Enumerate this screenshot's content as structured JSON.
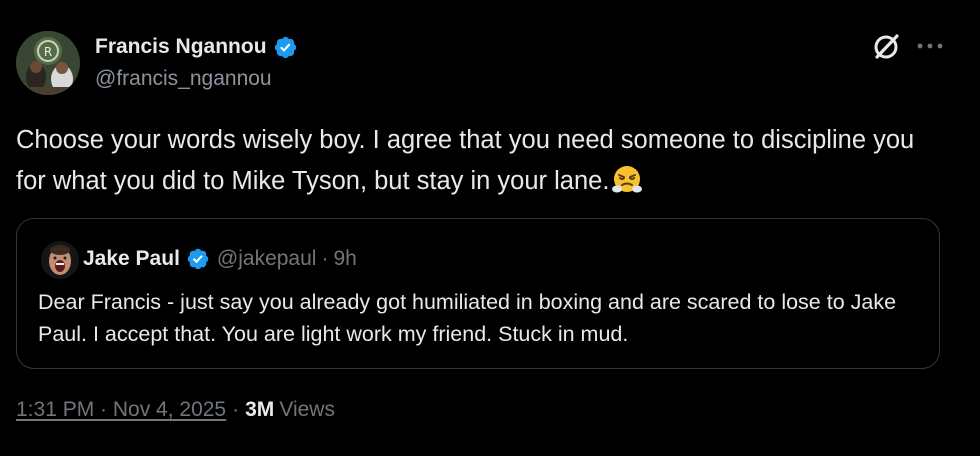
{
  "author": {
    "display_name": "Francis Ngannou",
    "handle": "@francis_ngannou",
    "verified": true
  },
  "tweet": {
    "text": "Choose your words wisely boy. I agree that you need someone to discipline you for what you did to Mike Tyson, but stay in your lane.",
    "emoji": "face-with-steam-from-nose"
  },
  "quoted": {
    "display_name": "Jake Paul",
    "handle": "@jakepaul",
    "separator": "·",
    "time": "9h",
    "verified": true,
    "text": "Dear Francis - just say you already got humiliated in boxing and are scared to lose to Jake Paul. I accept that. You are light work my friend. Stuck in mud."
  },
  "meta": {
    "timestamp": "1:31 PM · Nov 4, 2025",
    "dot": "·",
    "views_count": "3M",
    "views_label": "Views"
  },
  "icons": {
    "grok": "grok-icon",
    "more": "more-icon",
    "verified": "verified-badge-icon"
  },
  "colors": {
    "background": "#000000",
    "primary_text": "#e7e9ea",
    "secondary_text": "#71767b",
    "verified": "#1d9bf0",
    "border": "#333639"
  }
}
